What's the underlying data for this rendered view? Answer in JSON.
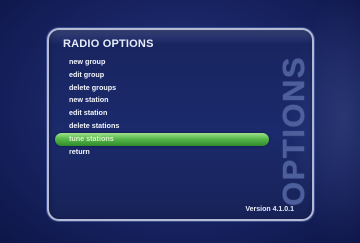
{
  "menu": {
    "title": "RADIO OPTIONS",
    "items": [
      {
        "label": "new group"
      },
      {
        "label": "edit group"
      },
      {
        "label": "delete groups"
      },
      {
        "label": "new station"
      },
      {
        "label": "edit station"
      },
      {
        "label": "delete stations"
      },
      {
        "label": "tune stations",
        "selected": true
      },
      {
        "label": "return"
      }
    ]
  },
  "side_label": "OPTIONS",
  "version": "Version 4.1.0.1",
  "colors": {
    "background": "#1a2768",
    "panel_border": "#b4bbd4",
    "selection_green": "#58b84a",
    "text": "#f2f4fb"
  }
}
